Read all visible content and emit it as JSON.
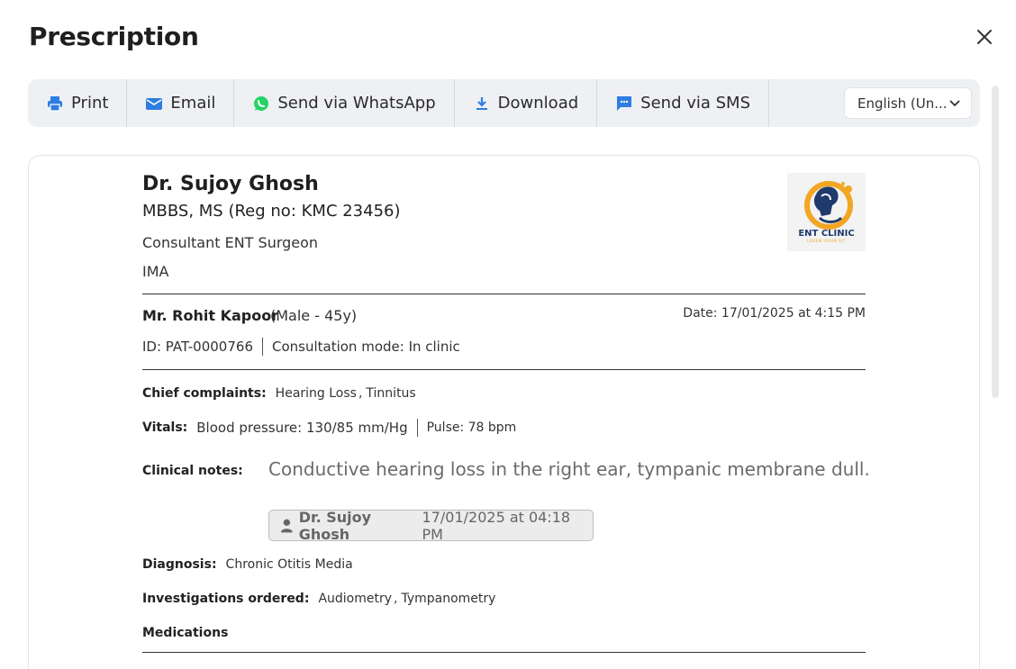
{
  "modal": {
    "title": "Prescription"
  },
  "toolbar": {
    "print_label": "Print",
    "email_label": "Email",
    "whatsapp_label": "Send via WhatsApp",
    "download_label": "Download",
    "sms_label": "Send via SMS",
    "language_value": "English (Un..."
  },
  "doctor": {
    "name": "Dr. Sujoy Ghosh",
    "qualifications": "MBBS, MS (Reg no: KMC 23456)",
    "role": "Consultant ENT Surgeon",
    "org": "IMA",
    "logo_text": "ENT CLINIC",
    "logo_sub": "LOREM IPSUM SIT"
  },
  "patient": {
    "name": "Mr. Rohit Kapoor",
    "meta": "(Male - 45y)",
    "date": "Date: 17/01/2025 at 4:15 PM",
    "id": "ID: PAT-0000766",
    "mode": "Consultation mode: In clinic"
  },
  "chief_complaints": {
    "label": "Chief complaints:",
    "items": [
      "Hearing Loss",
      "Tinnitus"
    ]
  },
  "vitals": {
    "label": "Vitals:",
    "bp": "Blood pressure: 130/85 mm/Hg",
    "pulse": "Pulse: 78 bpm"
  },
  "clinical_notes": {
    "label": "Clinical notes:",
    "text": "Conductive hearing loss in the right ear, tympanic membrane dull.",
    "author": "Dr. Sujoy Ghosh",
    "timestamp": "17/01/2025 at 04:18 PM"
  },
  "diagnosis": {
    "label": "Diagnosis:",
    "value": "Chronic Otitis Media"
  },
  "investigations": {
    "label": "Investigations ordered:",
    "items": [
      "Audiometry",
      "Tympanometry"
    ]
  },
  "medications": {
    "label": "Medications"
  },
  "colors": {
    "toolbar_bg": "#eef0f4",
    "email_icon": "#2f7de1",
    "whatsapp_icon": "#25d366",
    "download_icon": "#2f7de1",
    "sms_icon": "#2f7de1",
    "print_icon": "#2f7de1"
  }
}
